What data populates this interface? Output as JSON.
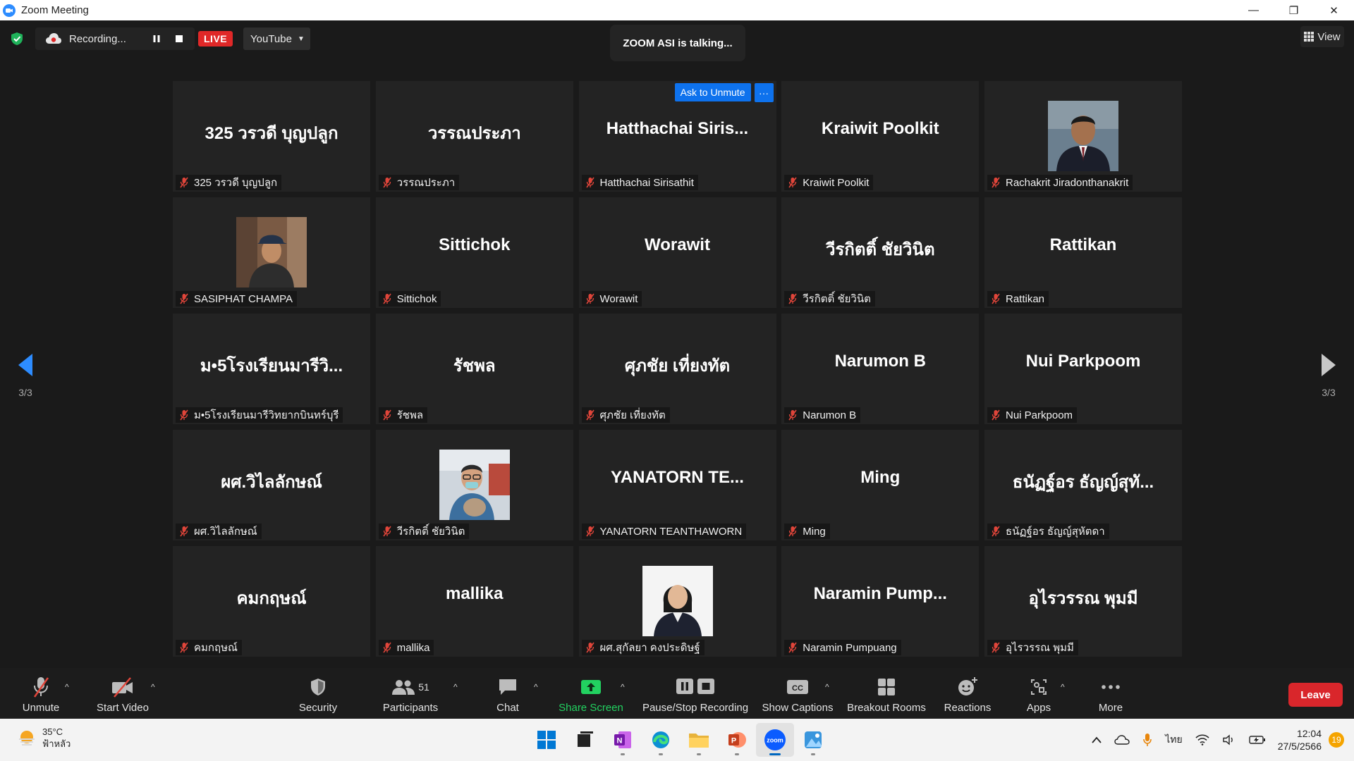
{
  "window": {
    "title": "Zoom Meeting",
    "minimize": "—",
    "restore": "❐",
    "close": "✕"
  },
  "topbar": {
    "recording_label": "Recording...",
    "live_label": "LIVE",
    "stream_target": "YouTube",
    "talking_indicator": "ZOOM ASI is talking...",
    "view_label": "View"
  },
  "grid": {
    "ask_unmute_label": "Ask to Unmute",
    "more_label": "···",
    "page_indicator": "3/3",
    "tiles": [
      {
        "big": "325 วรวดี บุญปลูก",
        "name": "325 วรวดี บุญปลูก",
        "photo": false
      },
      {
        "big": "วรรณประภา",
        "name": "วรรณประภา",
        "photo": false
      },
      {
        "big": "Hatthachai  Siris...",
        "name": "Hatthachai Sirisathit",
        "photo": false,
        "hover": true
      },
      {
        "big": "Kraiwit Poolkit",
        "name": "Kraiwit Poolkit",
        "photo": false
      },
      {
        "big": "",
        "name": "Rachakrit Jiradonthanakrit",
        "photo": true,
        "photo_style": "man-suit"
      },
      {
        "big": "",
        "name": "SASIPHAT CHAMPA",
        "photo": true,
        "photo_style": "woman-cap"
      },
      {
        "big": "Sittichok",
        "name": "Sittichok",
        "photo": false
      },
      {
        "big": "Worawit",
        "name": "Worawit",
        "photo": false
      },
      {
        "big": "วีรกิตติ์ ชัยวินิต",
        "name": "วีรกิตติ์ ชัยวินิต",
        "photo": false
      },
      {
        "big": "Rattikan",
        "name": "Rattikan",
        "photo": false
      },
      {
        "big": "ม•5โรงเรียนมารีวิ...",
        "name": "ม•5โรงเรียนมารีวิทยากบินทร์บุรี",
        "photo": false
      },
      {
        "big": "รัชพล",
        "name": "รัชพล",
        "photo": false
      },
      {
        "big": "ศุภชัย เที่ยงทัต",
        "name": "ศุภชัย เที่ยงทัต",
        "photo": false
      },
      {
        "big": "Narumon B",
        "name": "Narumon B",
        "photo": false
      },
      {
        "big": "Nui Parkpoom",
        "name": "Nui Parkpoom",
        "photo": false
      },
      {
        "big": "ผศ.วิไลลักษณ์",
        "name": "ผศ.วิไลลักษณ์",
        "photo": false
      },
      {
        "big": "",
        "name": "วีรกิตติ์ ชัยวินิต",
        "photo": true,
        "photo_style": "man-glasses"
      },
      {
        "big": "YANATORN  TE...",
        "name": "YANATORN TEANTHAWORN",
        "photo": false
      },
      {
        "big": "Ming",
        "name": "Ming",
        "photo": false
      },
      {
        "big": "ธนัฏฐ์อร ธัญญ์สุทั...",
        "name": "ธนัฏฐ์อร ธัญญ์สุหัตดา",
        "photo": false
      },
      {
        "big": "คมกฤษณ์",
        "name": "คมกฤษณ์",
        "photo": false
      },
      {
        "big": "mallika",
        "name": "mallika",
        "photo": false
      },
      {
        "big": "",
        "name": "ผศ.สุกัลยา คงประดิษฐ์",
        "photo": true,
        "photo_style": "woman-formal"
      },
      {
        "big": "Naramin  Pump...",
        "name": "Naramin Pumpuang",
        "photo": false
      },
      {
        "big": "อุไรวรรณ พุมมี",
        "name": "อุไรวรรณ พุมมี",
        "photo": false
      }
    ]
  },
  "toolbar": {
    "unmute": "Unmute",
    "start_video": "Start Video",
    "security": "Security",
    "participants": "Participants",
    "participant_count": "51",
    "chat": "Chat",
    "share_screen": "Share Screen",
    "pause_stop_recording": "Pause/Stop Recording",
    "show_captions": "Show Captions",
    "breakout_rooms": "Breakout Rooms",
    "reactions": "Reactions",
    "apps": "Apps",
    "more": "More",
    "leave": "Leave"
  },
  "taskbar": {
    "temperature": "35°C",
    "weather_desc": "ฟ้าหลัว",
    "language": "ไทย",
    "time": "12:04",
    "date": "27/5/2566",
    "notification_count": "19"
  },
  "colors": {
    "accent_blue": "#0e72ed",
    "live_red": "#e02828",
    "leave_red": "#d9262b",
    "share_green": "#22d160",
    "muted_red": "#e0453a"
  }
}
